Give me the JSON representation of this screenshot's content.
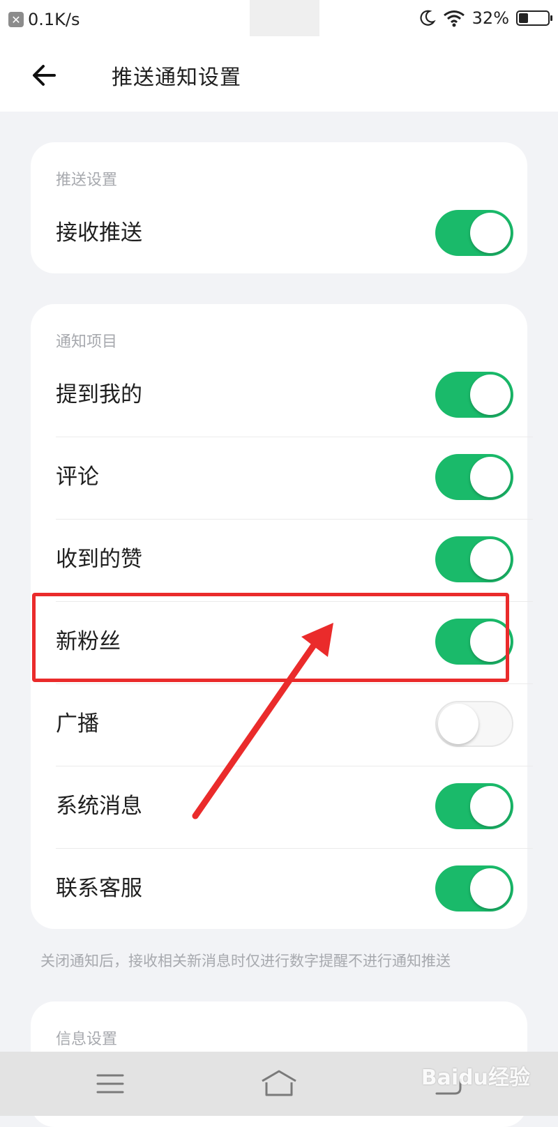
{
  "status_bar": {
    "speed": "0.1K/s",
    "battery_text": "32%",
    "battery_level": 0.32
  },
  "header": {
    "title": "推送通知设置"
  },
  "push_section": {
    "label": "推送设置",
    "items": [
      {
        "label": "接收推送",
        "enabled": true
      }
    ]
  },
  "notify_section": {
    "label": "通知项目",
    "items": [
      {
        "label": "提到我的",
        "enabled": true
      },
      {
        "label": "评论",
        "enabled": true
      },
      {
        "label": "收到的赞",
        "enabled": true
      },
      {
        "label": "新粉丝",
        "enabled": true
      },
      {
        "label": "广播",
        "enabled": false
      },
      {
        "label": "系统消息",
        "enabled": true
      },
      {
        "label": "联系客服",
        "enabled": true
      }
    ]
  },
  "footnote": "关闭通知后，接收相关新消息时仅进行数字提醒不进行通知推送",
  "info_section": {
    "label": "信息设置"
  },
  "colors": {
    "toggle_on": "#1aba6a",
    "annotation": "#ea2b2b"
  },
  "watermark": "Baidu经验"
}
